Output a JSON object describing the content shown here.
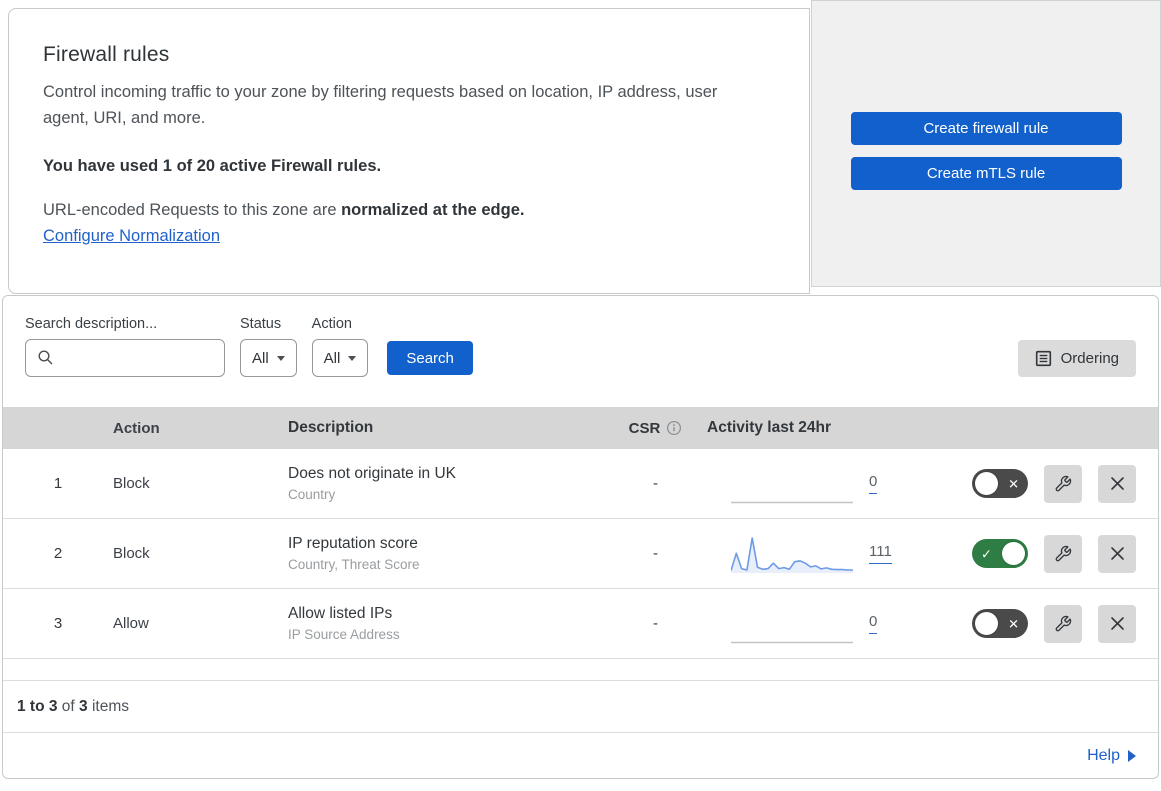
{
  "header": {
    "title": "Firewall rules",
    "description": "Control incoming traffic to your zone by filtering requests based on location, IP address, user agent, URI, and more.",
    "usage": "You have used 1 of 20 active Firewall rules.",
    "normalization_prefix": "URL-encoded Requests to this zone are ",
    "normalization_bold": "normalized at the edge.",
    "normalization_link": "Configure Normalization"
  },
  "actions_panel": {
    "create_firewall_rule_label": "Create firewall rule",
    "create_mtls_rule_label": "Create mTLS rule"
  },
  "filters": {
    "search_label": "Search description...",
    "search_value": "",
    "status_label": "Status",
    "status_value": "All",
    "action_label": "Action",
    "action_value": "All",
    "search_button_label": "Search",
    "ordering_button_label": "Ordering"
  },
  "table": {
    "columns": {
      "action": "Action",
      "description": "Description",
      "csr": "CSR",
      "activity": "Activity last 24hr"
    },
    "rows": [
      {
        "priority": "1",
        "action": "Block",
        "description": "Does not originate in UK",
        "fields": "Country",
        "csr": "-",
        "activity_count": "0",
        "enabled": false,
        "sparkline": []
      },
      {
        "priority": "2",
        "action": "Block",
        "description": "IP reputation score",
        "fields": "Country, Threat Score",
        "csr": "-",
        "activity_count": "111",
        "enabled": true,
        "sparkline": [
          4,
          55,
          10,
          6,
          100,
          14,
          8,
          10,
          26,
          10,
          13,
          8,
          30,
          33,
          26,
          15,
          18,
          9,
          12,
          8,
          7,
          7,
          6,
          6
        ]
      },
      {
        "priority": "3",
        "action": "Allow",
        "description": "Allow listed IPs",
        "fields": "IP Source Address",
        "csr": "-",
        "activity_count": "0",
        "enabled": false,
        "sparkline": []
      }
    ]
  },
  "footer": {
    "range_bold": "1 to 3",
    "of_text": " of ",
    "total_bold": "3",
    "items_text": " items",
    "help_label": "Help"
  },
  "icons": {
    "toggle_on_glyph": "✓",
    "toggle_off_glyph": "✕"
  },
  "chart_data": {
    "type": "area",
    "title": "Activity last 24hr sparkline (rule 2: IP reputation score)",
    "x_axis": "hidden, last 24 hours",
    "series": [
      {
        "name": "Rule 2 activity",
        "values": [
          4,
          55,
          10,
          6,
          100,
          14,
          8,
          10,
          26,
          10,
          13,
          8,
          30,
          33,
          26,
          15,
          18,
          9,
          12,
          8,
          7,
          7,
          6,
          6
        ]
      }
    ],
    "total_events": 111
  },
  "colors": {
    "accent_blue": "#1160cb",
    "link_blue": "#2062c9",
    "toggle_on_green": "#2e7d44",
    "toggle_off_gray": "#4a4a4a",
    "sparkline_blue": "#6e9be6",
    "sparkline_fill": "rgba(110,155,230,0.16)",
    "empty_sparkline_gray": "#c4c4c4",
    "table_header_bg": "#d6d6d6"
  }
}
